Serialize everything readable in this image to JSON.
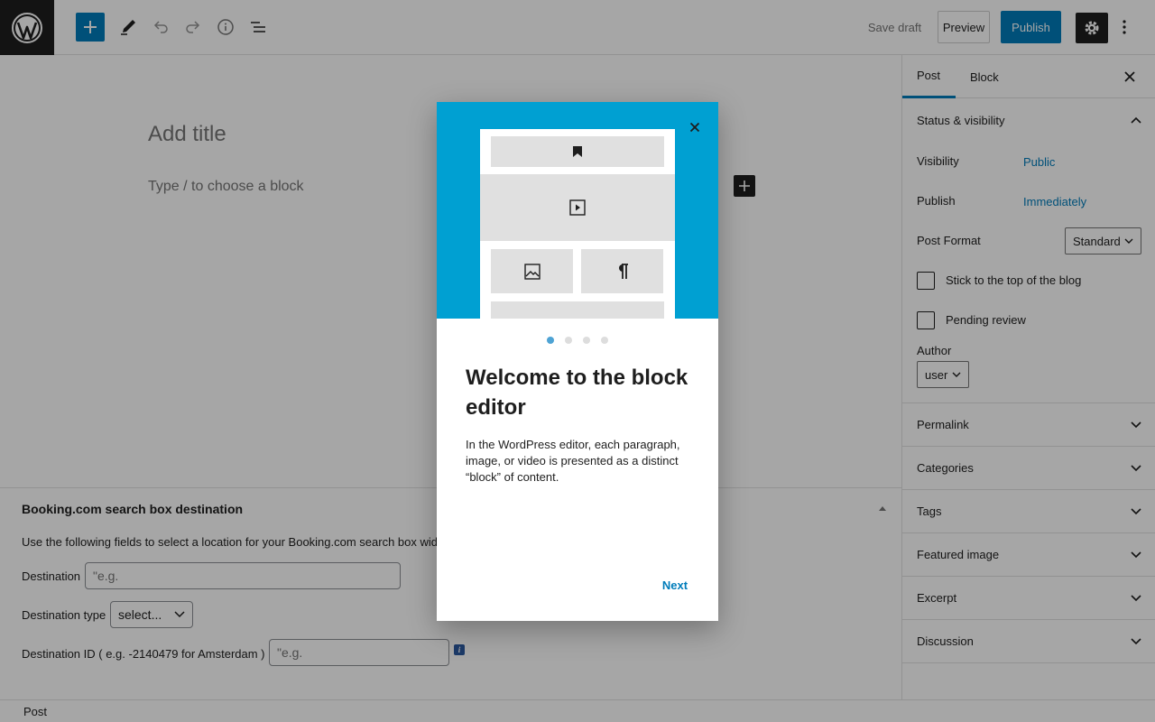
{
  "toolbar": {
    "save_draft": "Save draft",
    "preview": "Preview",
    "publish": "Publish"
  },
  "editor": {
    "title_placeholder": "Add title",
    "block_placeholder": "Type / to choose a block"
  },
  "metabox": {
    "title": "Booking.com search box destination",
    "description": "Use the following fields to select a location for your Booking.com search box wid",
    "destination_label": "Destination",
    "destination_placeholder": "\"e.g.",
    "destination_type_label": "Destination type",
    "destination_type_value": "select...",
    "destination_id_label": "Destination ID ( e.g. -2140479 for Amsterdam )",
    "destination_id_placeholder": "\"e.g.",
    "info_glyph": "i"
  },
  "footer": {
    "breadcrumb": "Post"
  },
  "sidebar": {
    "tabs": [
      "Post",
      "Block"
    ],
    "status_panel": "Status & visibility",
    "visibility_label": "Visibility",
    "visibility_value": "Public",
    "publish_label": "Publish",
    "publish_value": "Immediately",
    "post_format_label": "Post Format",
    "post_format_value": "Standard",
    "stick_label": "Stick to the top of the blog",
    "pending_label": "Pending review",
    "author_label": "Author",
    "author_value": "user",
    "panels": [
      "Permalink",
      "Categories",
      "Tags",
      "Featured image",
      "Excerpt",
      "Discussion"
    ]
  },
  "modal": {
    "heading": "Welcome to the block editor",
    "text": "In the WordPress editor, each paragraph, image, or video is presented as a distinct “block” of content.",
    "next": "Next",
    "page_count": 4,
    "current_page": 1
  },
  "colors": {
    "accent": "#007cba",
    "hero": "#00a0d2",
    "dark": "#1e1e1e"
  }
}
